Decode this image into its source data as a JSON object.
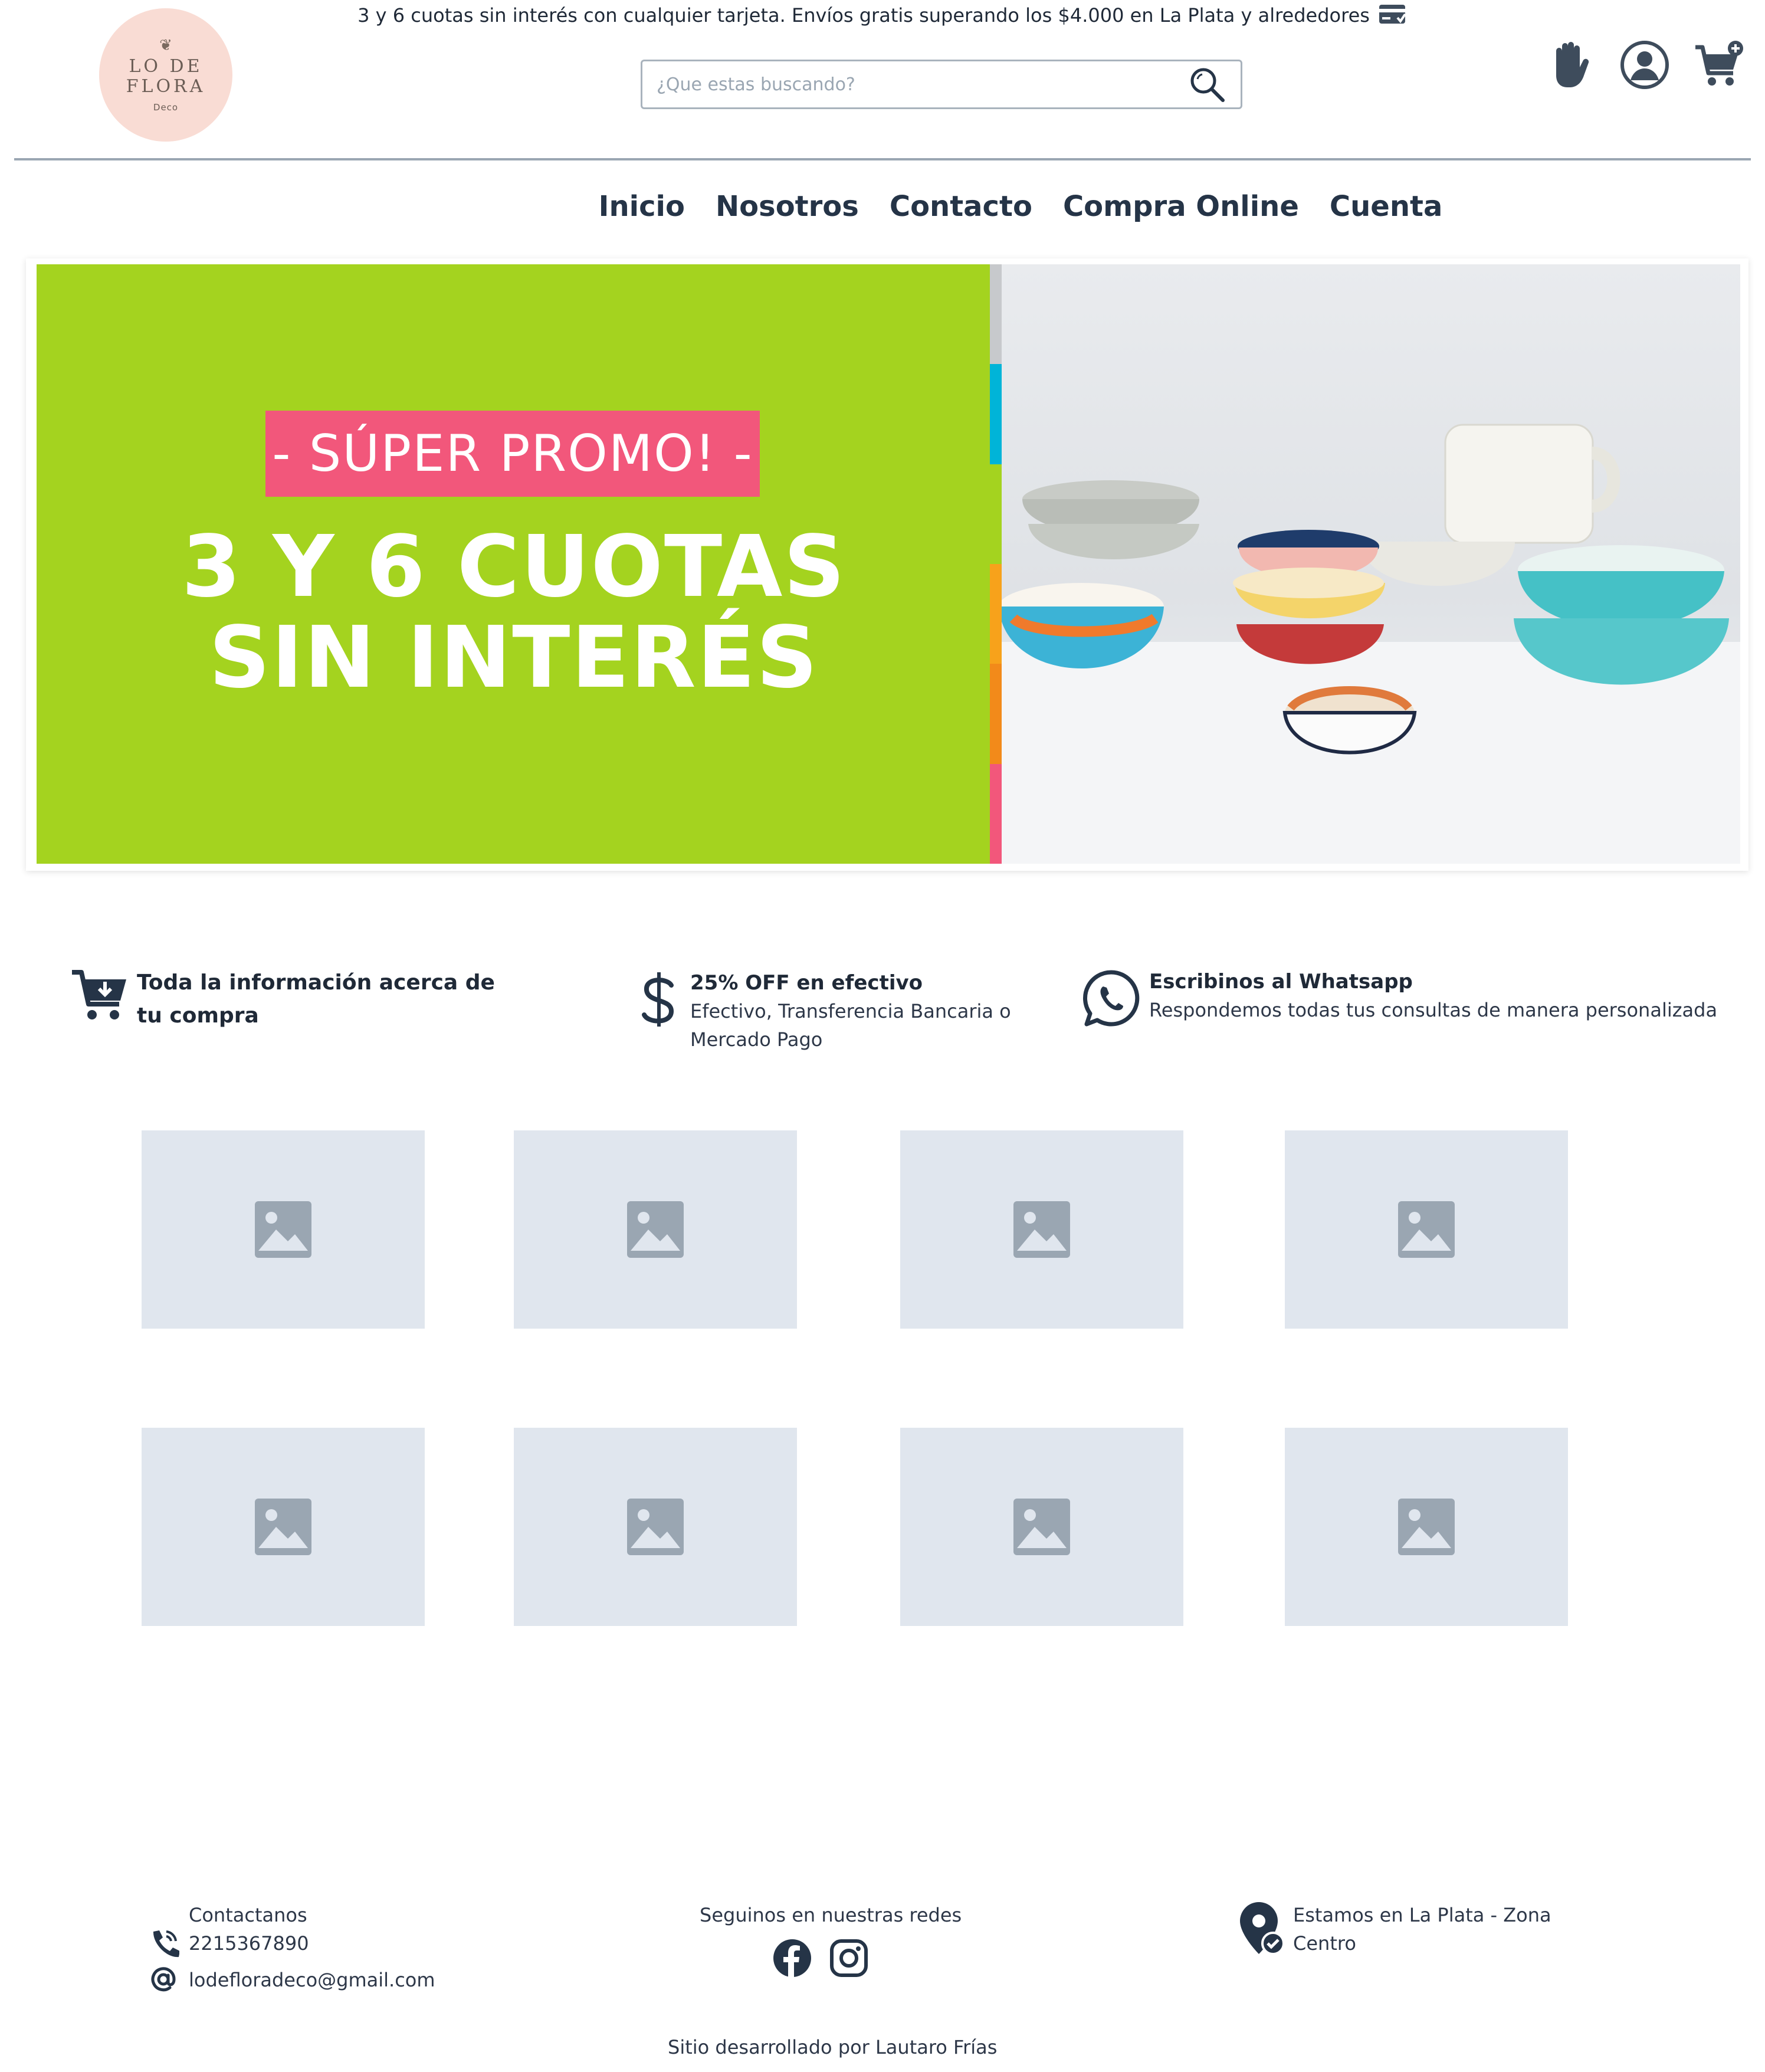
{
  "header": {
    "logo": {
      "line1": "LO DE",
      "line2": "FLORA",
      "line3": "Deco"
    },
    "announcement": "3 y 6 cuotas sin interés con cualquier tarjeta. Envíos gratis superando los $4.000 en La Plata y alrededores",
    "search": {
      "placeholder": "¿Que estas buscando?",
      "value": ""
    },
    "icons": [
      "hand-icon",
      "user-icon",
      "cart-plus-icon"
    ]
  },
  "nav": {
    "items": [
      {
        "label": "Inicio"
      },
      {
        "label": "Nosotros"
      },
      {
        "label": "Contacto"
      },
      {
        "label": "Compra Online"
      },
      {
        "label": "Cuenta"
      }
    ]
  },
  "banner": {
    "label": "- SÚPER PROMO! -",
    "line1": "3 Y 6 CUOTAS",
    "line2": "SIN INTERÉS",
    "colors": {
      "green": "#a4d31f",
      "pink": "#f2577b",
      "stripes": [
        "#c7c9cc",
        "#00b4d8",
        "#a4d31f",
        "#f7a21b",
        "#f28a1a",
        "#f2577b"
      ]
    }
  },
  "features": [
    {
      "icon": "cart-download-icon",
      "title": "Toda la información acerca de tu compra",
      "desc": ""
    },
    {
      "icon": "dollar-icon",
      "title": "25% OFF en efectivo",
      "desc": "Efectivo, Transferencia Bancaria o Mercado Pago"
    },
    {
      "icon": "whatsapp-icon",
      "title": "Escribinos al Whatsapp",
      "desc": "Respondemos todas tus consultas de manera personalizada"
    }
  ],
  "products": [
    {
      "icon": "image-placeholder-icon"
    },
    {
      "icon": "image-placeholder-icon"
    },
    {
      "icon": "image-placeholder-icon"
    },
    {
      "icon": "image-placeholder-icon"
    },
    {
      "icon": "image-placeholder-icon"
    },
    {
      "icon": "image-placeholder-icon"
    },
    {
      "icon": "image-placeholder-icon"
    },
    {
      "icon": "image-placeholder-icon"
    }
  ],
  "footer": {
    "contact": {
      "heading": "Contactanos",
      "phone": "2215367890",
      "email": "lodefloradeco@gmail.com"
    },
    "social": {
      "heading": "Seguinos en nuestras redes",
      "icons": [
        "facebook-icon",
        "instagram-icon"
      ]
    },
    "location": {
      "line1": "Estamos en La Plata - Zona",
      "line2": "Centro"
    },
    "credit": "Sitio desarrollado por Lautaro Frías"
  }
}
